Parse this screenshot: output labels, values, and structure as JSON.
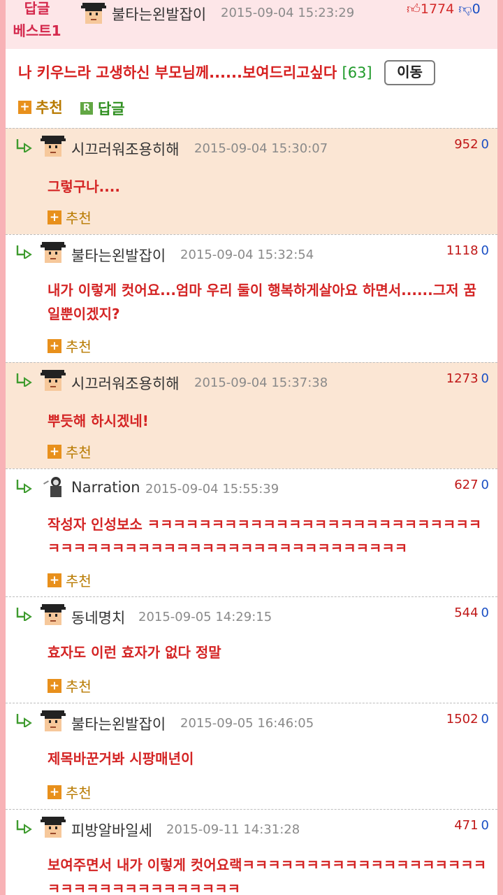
{
  "best": {
    "label_line1": "답글",
    "label_line2": "베스트1",
    "nickname": "불타는왼발잡이",
    "date": "2015-09-04 15:23:29",
    "likes": "1774",
    "dislikes": "0",
    "title": "나 키우느라 고생하신 부모님께......보여드리고싶다",
    "reply_count": "[63]",
    "move_label": "이동",
    "recommend_label": "추천",
    "reply_label": "답글"
  },
  "comments": [
    {
      "nickname": "시끄러워조용히해",
      "date": "2015-09-04 15:30:07",
      "likes": "952",
      "dislikes": "0",
      "text": "그렇구나....",
      "recommend": "추천"
    },
    {
      "nickname": "불타는왼발잡이",
      "date": "2015-09-04 15:32:54",
      "likes": "1118",
      "dislikes": "0",
      "text": "내가 이렇게 컷어요...엄마 우리 둘이 행복하게살아요 하면서......그저 꿈일뿐이겠지?",
      "recommend": "추천"
    },
    {
      "nickname": "시끄러워조용히해",
      "date": "2015-09-04 15:37:38",
      "likes": "1273",
      "dislikes": "0",
      "text": "뿌듯해 하시겠네!",
      "recommend": "추천"
    },
    {
      "nickname": "Narration",
      "date": "2015-09-04 15:55:39",
      "likes": "627",
      "dislikes": "0",
      "text": "작성자 인성보소 ㅋㅋㅋㅋㅋㅋㅋㅋㅋㅋㅋㅋㅋㅋㅋㅋㅋㅋㅋㅋㅋㅋㅋㅋㅋㅋㅋㅋㅋㅋㅋㅋㅋㅋㅋㅋㅋㅋㅋㅋㅋㅋㅋㅋㅋㅋㅋㅋㅋㅋㅋㅋㅋㅋ",
      "recommend": "추천"
    },
    {
      "nickname": "동네명치",
      "date": "2015-09-05 14:29:15",
      "likes": "544",
      "dislikes": "0",
      "text": "효자도 이런 효자가 없다 정말",
      "recommend": "추천"
    },
    {
      "nickname": "불타는왼발잡이",
      "date": "2015-09-05 16:46:05",
      "likes": "1502",
      "dislikes": "0",
      "text": "제목바꾼거봐 시팡매년이",
      "recommend": "추천"
    },
    {
      "nickname": "피방알바일세",
      "date": "2015-09-11 14:31:28",
      "likes": "471",
      "dislikes": "0",
      "text": "보여주면서 내가 이렇게 컷어요랙ㅋㅋㅋㅋㅋㅋㅋㅋㅋㅋㅋㅋㅋㅋㅋㅋㅋㅋㅋㅋㅋㅋㅋㅋㅋㅋㅋㅋㅋㅋㅋㅋㅋㅋ",
      "recommend": "추천"
    }
  ],
  "icons": {
    "reply_arrow": "reply-arrow-icon",
    "avatar": "pixel-avatar-icon",
    "narration_avatar": "narration-avatar-icon",
    "thumbs_up": "thumbs-up-icon",
    "thumbs_down": "thumbs-down-icon",
    "recommend": "plus-icon"
  },
  "colors": {
    "accent_pink": "#f8b2b6",
    "highlight_row": "#fbe6d4",
    "comment_text": "#d42424",
    "recommend_text": "#b87a00"
  }
}
